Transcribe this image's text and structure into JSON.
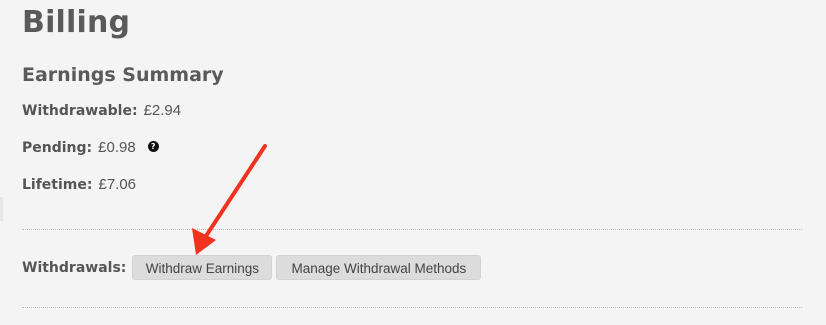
{
  "page": {
    "title": "Billing"
  },
  "earnings_summary": {
    "title": "Earnings Summary",
    "withdrawable": {
      "label": "Withdrawable:",
      "value": "£2.94"
    },
    "pending": {
      "label": "Pending:",
      "value": "£0.98",
      "help_icon_glyph": "?"
    },
    "lifetime": {
      "label": "Lifetime:",
      "value": "£7.06"
    }
  },
  "withdrawals": {
    "label": "Withdrawals:",
    "withdraw_button": "Withdraw Earnings",
    "manage_button": "Manage Withdrawal Methods"
  },
  "annotation": {
    "arrow_color": "#f0321e"
  }
}
